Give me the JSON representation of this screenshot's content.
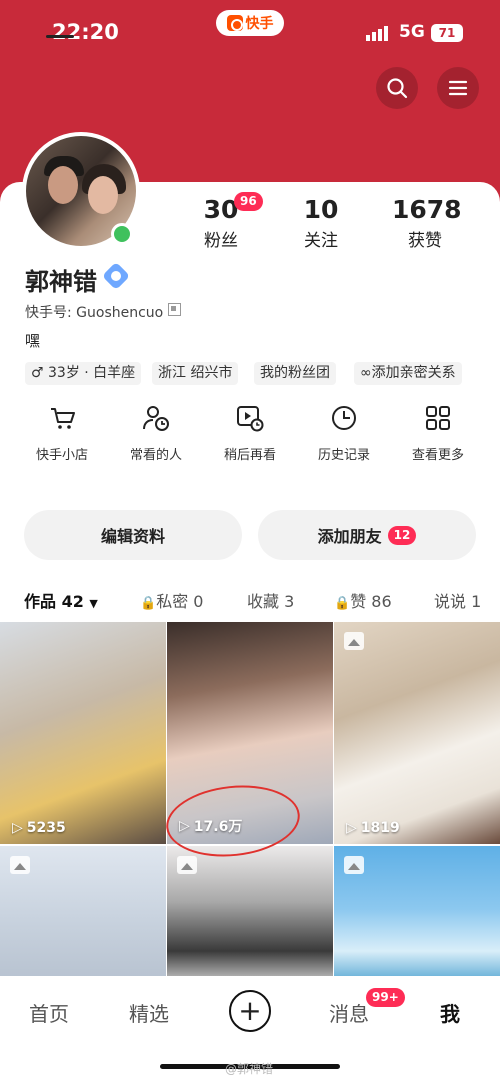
{
  "status_bar": {
    "time": "22:20",
    "app_name": "快手",
    "network": "5G",
    "battery": "71"
  },
  "header": {
    "search_icon": "search-icon",
    "menu_icon": "menu-icon",
    "accent": "#c82a3a"
  },
  "profile": {
    "name": "郭神错",
    "kuaishou_id": "快手号: Guoshencuo",
    "bio": "嘿",
    "online": true
  },
  "stats": [
    {
      "num": "30",
      "label": "粉丝",
      "badge": "96"
    },
    {
      "num": "10",
      "label": "关注"
    },
    {
      "num": "1678",
      "label": "获赞"
    }
  ],
  "tags": [
    "33岁 · 白羊座",
    "浙江 绍兴市",
    "我的粉丝团",
    "添加亲密关系"
  ],
  "quick_links": [
    {
      "label": "快手小店",
      "icon": "cart-icon"
    },
    {
      "label": "常看的人",
      "icon": "person-clock-icon"
    },
    {
      "label": "稍后再看",
      "icon": "play-clock-icon"
    },
    {
      "label": "历史记录",
      "icon": "clock-icon"
    },
    {
      "label": "查看更多",
      "icon": "grid-icon"
    }
  ],
  "actions": {
    "edit": "编辑资料",
    "add_friend": "添加朋友",
    "add_friend_badge": "12"
  },
  "tabs": [
    {
      "label": "作品 42",
      "active": true
    },
    {
      "label": "私密 0",
      "locked": true
    },
    {
      "label": "收藏 3"
    },
    {
      "label": "赞 86",
      "locked": true
    },
    {
      "label": "说说 1"
    }
  ],
  "grid": [
    {
      "views": "5235",
      "type": "video"
    },
    {
      "views": "17.6万",
      "type": "video"
    },
    {
      "views": "1819",
      "type": "image"
    },
    {
      "type": "image"
    },
    {
      "type": "image"
    },
    {
      "type": "image"
    }
  ],
  "bottom_nav": [
    {
      "label": "首页"
    },
    {
      "label": "精选"
    },
    {
      "label": "消息",
      "badge": "99+"
    },
    {
      "label": "我",
      "active": true
    }
  ],
  "watermark": "@郭神错"
}
